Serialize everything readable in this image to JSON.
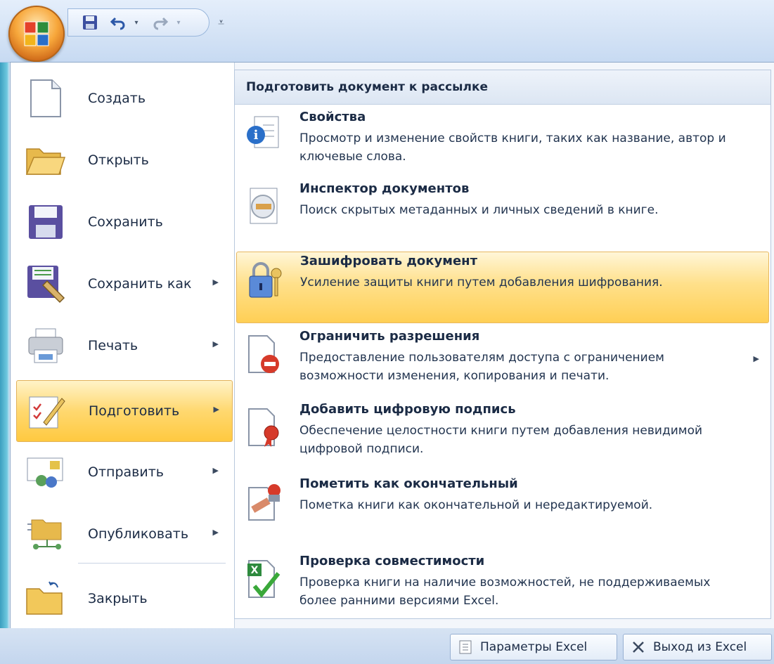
{
  "quick_access": {
    "save_icon": "save-icon",
    "undo_icon": "undo-icon",
    "redo_icon": "redo-icon",
    "customize_icon": "customize-icon"
  },
  "left_menu": {
    "items": [
      {
        "label": "Создать",
        "icon": "new-document-icon",
        "has_submenu": false
      },
      {
        "label": "Открыть",
        "icon": "open-folder-icon",
        "has_submenu": false
      },
      {
        "label": "Сохранить",
        "icon": "save-icon",
        "has_submenu": false
      },
      {
        "label": "Сохранить как",
        "icon": "save-as-icon",
        "has_submenu": true
      },
      {
        "label": "Печать",
        "icon": "printer-icon",
        "has_submenu": true
      },
      {
        "label": "Подготовить",
        "icon": "prepare-icon",
        "has_submenu": true
      },
      {
        "label": "Отправить",
        "icon": "send-icon",
        "has_submenu": true
      },
      {
        "label": "Опубликовать",
        "icon": "publish-icon",
        "has_submenu": true
      },
      {
        "label": "Закрыть",
        "icon": "close-folder-icon",
        "has_submenu": false
      }
    ],
    "active_index": 5
  },
  "submenu": {
    "header": "Подготовить документ к рассылке",
    "items": [
      {
        "title": "Свойства",
        "desc": "Просмотр и изменение свойств книги, таких как название, автор и ключевые слова.",
        "icon": "properties-icon"
      },
      {
        "title": "Инспектор документов",
        "desc": "Поиск скрытых метаданных и личных сведений в книге.",
        "icon": "inspector-icon"
      },
      {
        "title": "Зашифровать документ",
        "desc": "Усиление защиты книги путем добавления шифрования.",
        "icon": "encrypt-lock-icon"
      },
      {
        "title": "Ограничить разрешения",
        "desc": "Предоставление пользователям доступа с ограничением возможности изменения, копирования и печати.",
        "icon": "restrict-permission-icon"
      },
      {
        "title": "Добавить цифровую подпись",
        "desc": "Обеспечение целостности книги путем добавления невидимой цифровой подписи.",
        "icon": "digital-signature-icon"
      },
      {
        "title": "Пометить как окончательный",
        "desc": "Пометка книги как окончательной и нередактируемой.",
        "icon": "mark-final-icon"
      },
      {
        "title": "Проверка совместимости",
        "desc": "Проверка книги на наличие возможностей, не поддерживаемых более ранними версиями Excel.",
        "icon": "compatibility-check-icon"
      }
    ],
    "active_index": 2
  },
  "bottom": {
    "options_label": "Параметры Excel",
    "exit_label": "Выход из Excel"
  },
  "colors": {
    "highlight": "#ffd86f",
    "menu_bg": "#ffffff",
    "text": "#1b2b45"
  }
}
